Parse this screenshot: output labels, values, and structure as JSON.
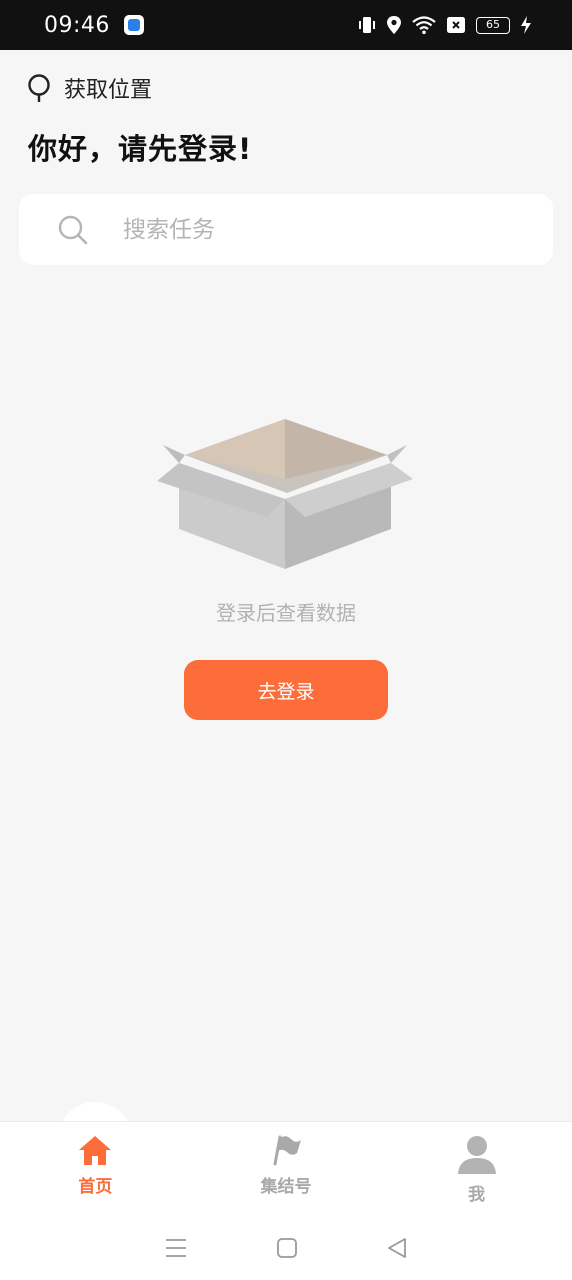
{
  "status_bar": {
    "time": "09:46",
    "battery": "65"
  },
  "header": {
    "location_label": "获取位置",
    "greeting": "你好，请先登录!"
  },
  "search": {
    "placeholder": "搜索任务",
    "value": ""
  },
  "empty_state": {
    "message": "登录后查看数据",
    "login_button": "去登录"
  },
  "tabs": [
    {
      "label": "首页",
      "icon": "home-icon",
      "active": true
    },
    {
      "label": "集结号",
      "icon": "flag-icon",
      "active": false
    },
    {
      "label": "我",
      "icon": "person-icon",
      "active": false
    }
  ],
  "colors": {
    "accent": "#fd6d3a",
    "inactive": "#a9a9a9",
    "background": "#f6f6f6"
  }
}
